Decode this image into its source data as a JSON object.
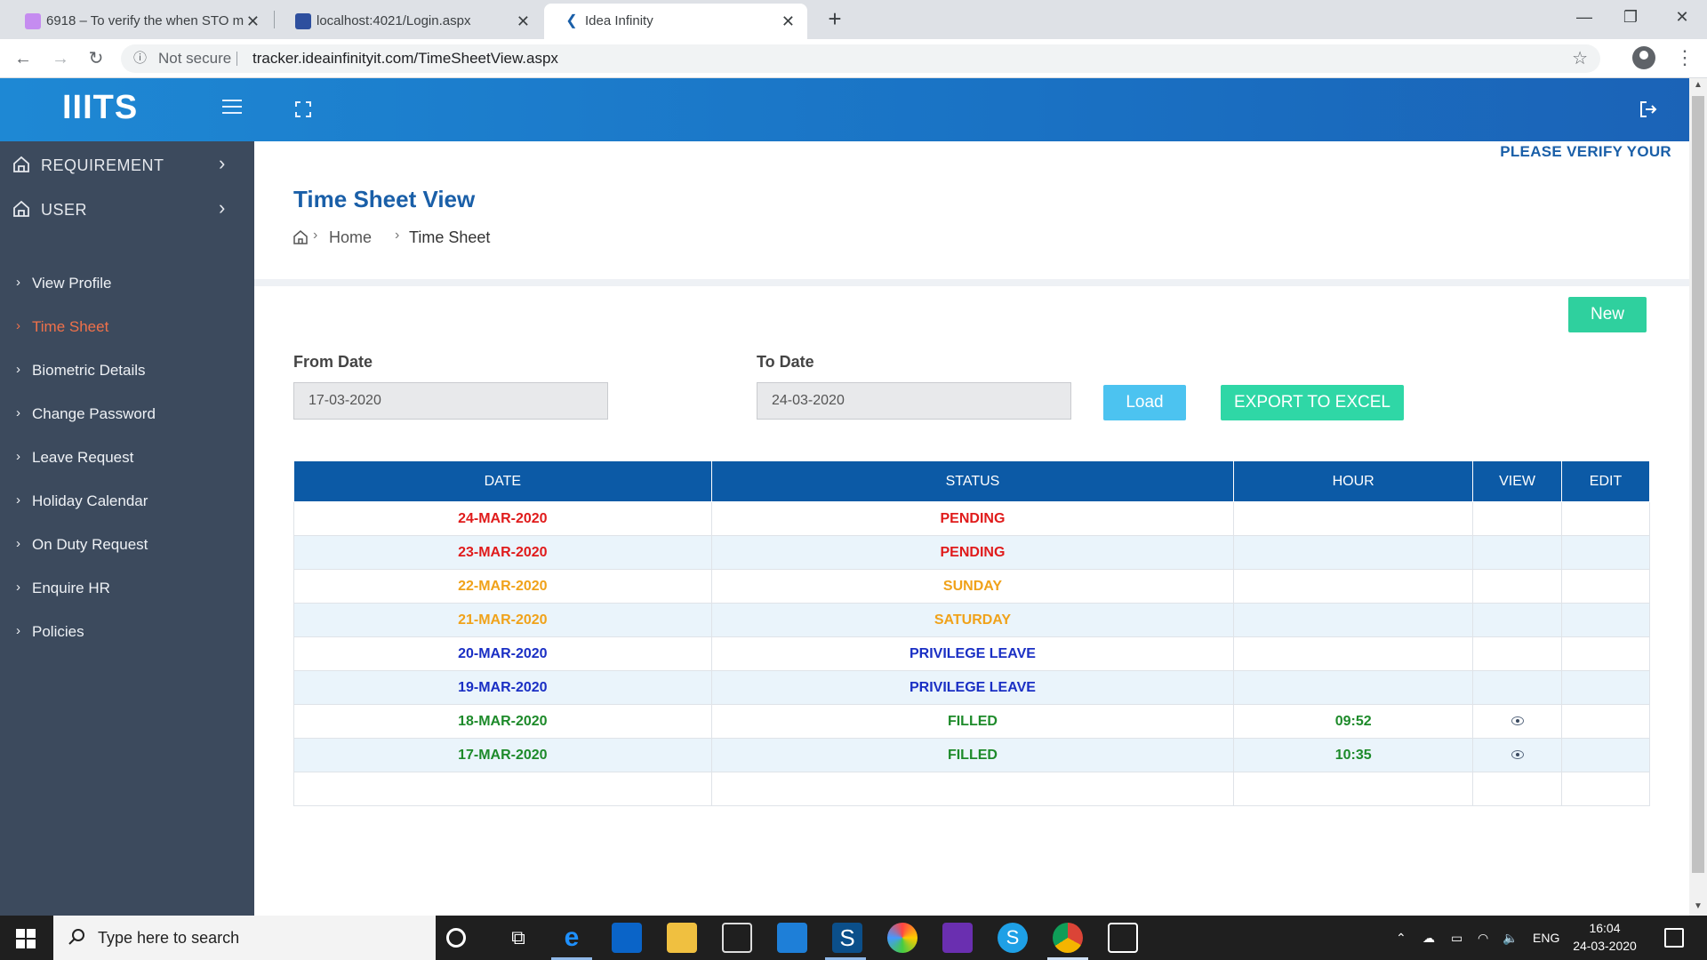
{
  "browser": {
    "tabs": [
      {
        "title": "6918 – To verify the when STO m",
        "active": false
      },
      {
        "title": "localhost:4021/Login.aspx",
        "active": false
      },
      {
        "title": "Idea Infinity",
        "active": true
      }
    ],
    "security_label": "Not secure",
    "url": "tracker.ideainfinityit.com/TimeSheetView.aspx"
  },
  "header": {
    "logo": "IIITS"
  },
  "sidebar": {
    "sections": [
      {
        "label": "REQUIREMENT",
        "icon": "home-icon"
      },
      {
        "label": "USER",
        "icon": "home-icon"
      }
    ],
    "items": [
      {
        "label": "View Profile",
        "active": false
      },
      {
        "label": "Time Sheet",
        "active": true
      },
      {
        "label": "Biometric Details",
        "active": false
      },
      {
        "label": "Change Password",
        "active": false
      },
      {
        "label": "Leave Request",
        "active": false
      },
      {
        "label": "Holiday Calendar",
        "active": false
      },
      {
        "label": "On Duty Request",
        "active": false
      },
      {
        "label": "Enquire HR",
        "active": false
      },
      {
        "label": "Policies",
        "active": false
      }
    ]
  },
  "page": {
    "notice": "PLEASE VERIFY YOUR",
    "title": "Time Sheet View",
    "breadcrumb": [
      "Home",
      "Time Sheet"
    ]
  },
  "form": {
    "new_label": "New",
    "from_label": "From Date",
    "from_value": "17-03-2020",
    "to_label": "To Date",
    "to_value": "24-03-2020",
    "load_label": "Load",
    "export_label": "EXPORT TO EXCEL"
  },
  "table": {
    "headers": [
      "DATE",
      "STATUS",
      "HOUR",
      "VIEW",
      "EDIT"
    ],
    "rows": [
      {
        "date": "24-MAR-2020",
        "status": "PENDING",
        "hour": "",
        "view": false,
        "kind": "pending"
      },
      {
        "date": "23-MAR-2020",
        "status": "PENDING",
        "hour": "",
        "view": false,
        "kind": "pending"
      },
      {
        "date": "22-MAR-2020",
        "status": "SUNDAY",
        "hour": "",
        "view": false,
        "kind": "weekend"
      },
      {
        "date": "21-MAR-2020",
        "status": "SATURDAY",
        "hour": "",
        "view": false,
        "kind": "weekend"
      },
      {
        "date": "20-MAR-2020",
        "status": "PRIVILEGE LEAVE",
        "hour": "",
        "view": false,
        "kind": "leave"
      },
      {
        "date": "19-MAR-2020",
        "status": "PRIVILEGE LEAVE",
        "hour": "",
        "view": false,
        "kind": "leave"
      },
      {
        "date": "18-MAR-2020",
        "status": "FILLED",
        "hour": "09:52",
        "view": true,
        "kind": "filled"
      },
      {
        "date": "17-MAR-2020",
        "status": "FILLED",
        "hour": "10:35",
        "view": true,
        "kind": "filled"
      }
    ]
  },
  "taskbar": {
    "search_placeholder": "Type here to search",
    "language": "ENG",
    "time": "16:04",
    "date": "24-03-2020"
  },
  "colors": {
    "header": "#1a72c4",
    "sidebar": "#3c4a5d",
    "active_item": "#f0714a",
    "table_header": "#0c5aa6",
    "pending": "#e01b1b",
    "weekend": "#f0a21a",
    "leave": "#1a2fc4",
    "filled": "#1d8a2a"
  }
}
